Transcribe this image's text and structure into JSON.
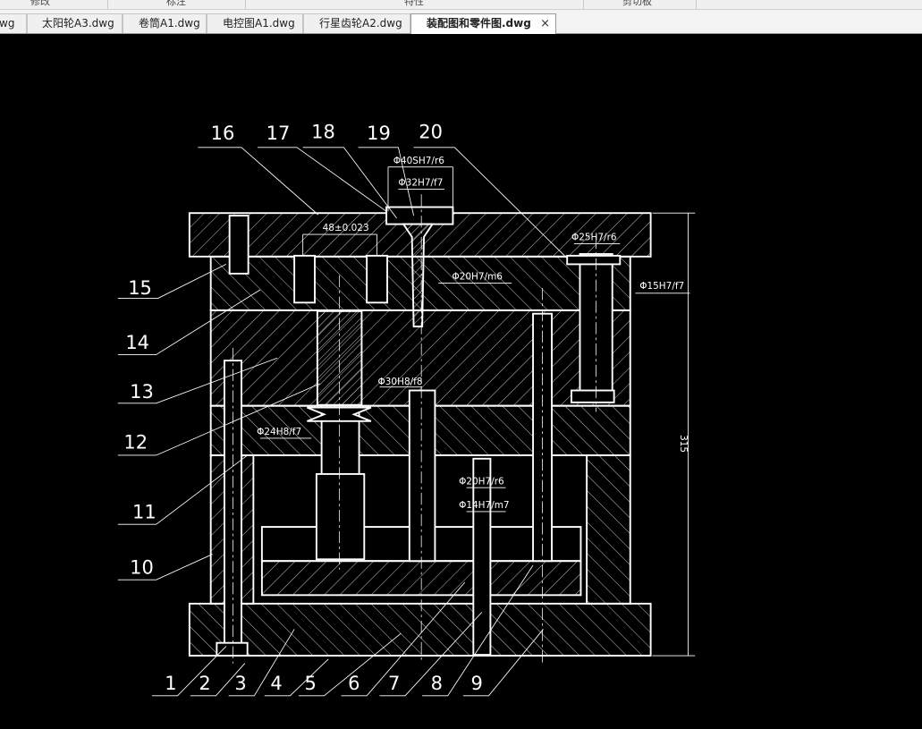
{
  "ribbon": {
    "panels": [
      "修改",
      "标注",
      "特性",
      "剪切板"
    ]
  },
  "tabs": [
    {
      "label": "wg",
      "active": false
    },
    {
      "label": "太阳轮A3.dwg",
      "active": false
    },
    {
      "label": "卷筒A1.dwg",
      "active": false
    },
    {
      "label": "电控图A1.dwg",
      "active": false
    },
    {
      "label": "行星齿轮A2.dwg",
      "active": false
    },
    {
      "label": "装配图和零件图.dwg",
      "active": true
    }
  ],
  "close_glyph": "×",
  "drawing": {
    "colors": {
      "background": "#000000",
      "lines": "#ffffff"
    },
    "part_numbers": [
      "1",
      "2",
      "3",
      "4",
      "5",
      "6",
      "7",
      "8",
      "9",
      "10",
      "11",
      "12",
      "13",
      "14",
      "15",
      "16",
      "17",
      "18",
      "19",
      "20"
    ],
    "dimensions": {
      "d40": "Φ40SH7/r6",
      "d32": "Φ32H7/f7",
      "d48": "48±0.023",
      "d25": "Φ25H7/r6",
      "d20m6": "Φ20H7/m6",
      "d15": "Φ15H7/f7",
      "d30": "Φ30H8/f8",
      "d24": "Φ24H8/f7",
      "d20r6": "Φ20H7/r6",
      "d14": "Φ14H7/m7",
      "h315": "315"
    }
  }
}
